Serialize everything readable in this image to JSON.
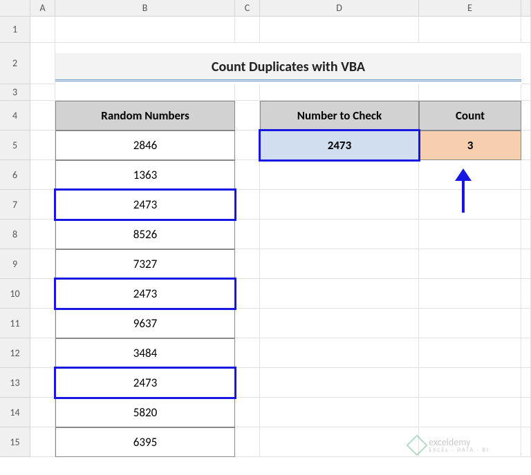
{
  "columns": [
    "",
    "A",
    "B",
    "C",
    "D",
    "E",
    ""
  ],
  "rows": [
    "1",
    "2",
    "3",
    "4",
    "5",
    "6",
    "7",
    "8",
    "9",
    "10",
    "11",
    "12",
    "13",
    "14",
    "15"
  ],
  "title": "Count Duplicates with VBA",
  "headers": {
    "random": "Random Numbers",
    "check": "Number to Check",
    "count": "Count"
  },
  "random_values": [
    "2846",
    "1363",
    "2473",
    "8526",
    "7327",
    "2473",
    "9637",
    "3484",
    "2473",
    "5820",
    "6395"
  ],
  "highlighted_rows": [
    2,
    5,
    8
  ],
  "check_value": "2473",
  "count_value": "3",
  "watermark": {
    "name": "exceldemy",
    "sub": "EXCEL · DATA · BI"
  }
}
